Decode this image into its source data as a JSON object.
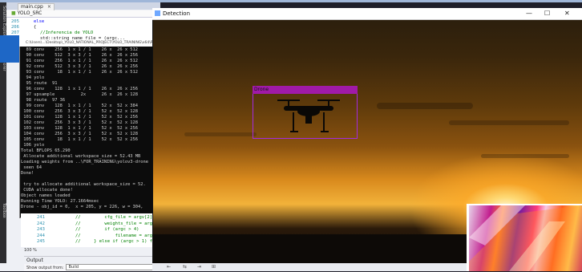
{
  "vs": {
    "side_labels": [
      "Solution Explorer",
      "Team Explorer",
      "Toolbox"
    ],
    "tab": {
      "label": "main.cpp",
      "close": "×"
    },
    "project": "YOLO_SRC",
    "code_lines": [
      {
        "n": "205",
        "text": "else"
      },
      {
        "n": "206",
        "text": "{"
      },
      {
        "n": "207",
        "text": "//Inferencia de YOLO"
      },
      {
        "n": "208",
        "text": "std::string name_file = (argc..."
      }
    ],
    "bottom_lines": [
      {
        "n": "241",
        "text": "//         cfg_file = argv[2];"
      },
      {
        "n": "242",
        "text": "//         weights_file = argv[3];"
      },
      {
        "n": "243",
        "text": "//         if (argc > 4)"
      },
      {
        "n": "244",
        "text": "//             filename = argv[4];"
      },
      {
        "n": "245",
        "text": "//     } else if (argc > 1) filenam"
      }
    ],
    "zoom": "100 %",
    "output_title": "Output",
    "show_output_label": "Show output from:",
    "show_output_value": "Build"
  },
  "console": {
    "title": "C:\\Users\\...\\Desktop\\_YOLO_NATIONAL_PROJECT\\YOLO_TRAINING\\x64\\Rel",
    "lines": [
      "  89 conv    256  1 x 1 / 1    26 x  26 x 512",
      "  90 conv    512  3 x 3 / 1    26 x  26 x 256",
      "  91 conv    256  1 x 1 / 1    26 x  26 x 512",
      "  92 conv    512  3 x 3 / 1    26 x  26 x 256",
      "  93 conv     18  1 x 1 / 1    26 x  26 x 512",
      "  94 yolo",
      "  95 route  91",
      "  96 conv    128  1 x 1 / 1    26 x  26 x 256",
      "  97 upsample          2x      26 x  26 x 128",
      "  98 route  97 36",
      "  99 conv    128  1 x 1 / 1    52 x  52 x 384",
      " 100 conv    256  3 x 3 / 1    52 x  52 x 128",
      " 101 conv    128  1 x 1 / 1    52 x  52 x 256",
      " 102 conv    256  3 x 3 / 1    52 x  52 x 128",
      " 103 conv    128  1 x 1 / 1    52 x  52 x 256",
      " 104 conv    256  3 x 3 / 1    52 x  52 x 128",
      " 105 conv     18  1 x 1 / 1    52 x  52 x 256",
      " 106 yolo",
      "Total BFLOPS 65.290",
      " Allocate additional workspace_size = 52.43 MB",
      "Loading weights from ..\\FOR_TRAINING\\yolov3-drone",
      " seen 64",
      "Done!",
      "",
      " try to allocate additional workspace_size = 52.",
      " CUDA allocate done!",
      "Object names loaded",
      "Running Time YOLO: 27.1664msec",
      "Drone - obj_id = 0,  x = 205, y = 226, w = 304,"
    ]
  },
  "detection": {
    "title": "Detection",
    "min": "—",
    "max": "☐",
    "close": "✕",
    "label": "Drone",
    "statusbar": [
      "⇤",
      "⇆",
      "⇥",
      "⊞"
    ]
  }
}
